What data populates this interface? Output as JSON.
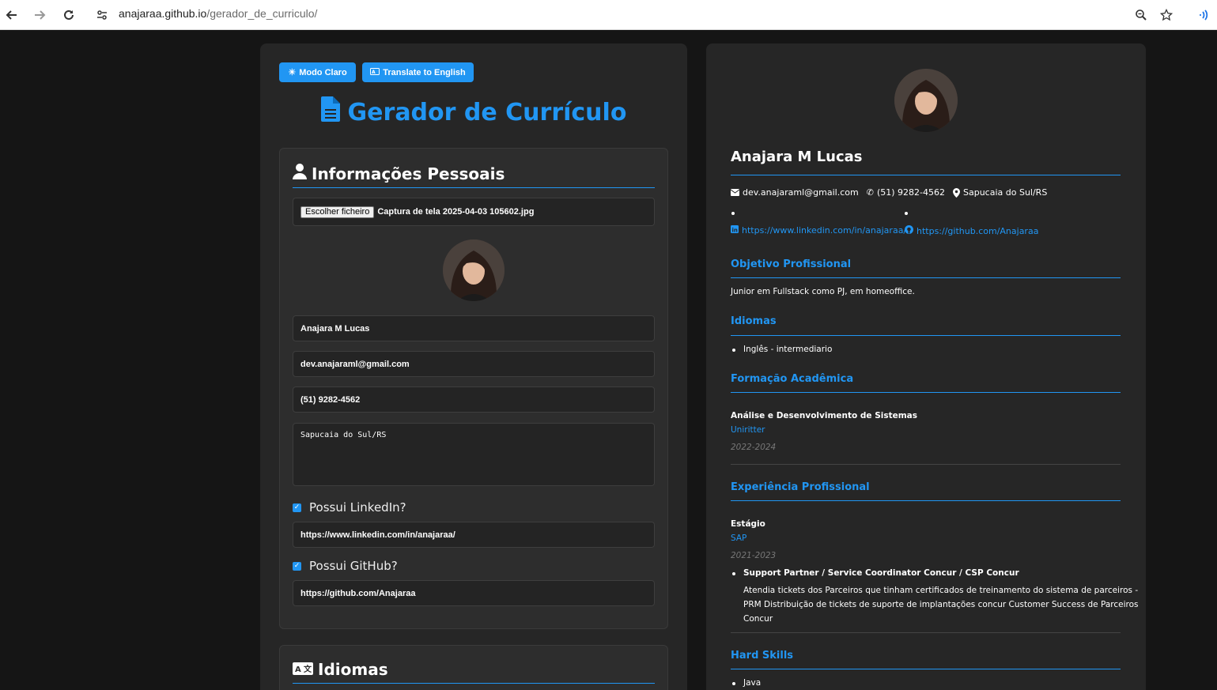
{
  "browser": {
    "url_host": "anajaraa.github.io",
    "url_path": "/gerador_de_curriculo/"
  },
  "toolbar": {
    "light_mode_label": "Modo Claro",
    "translate_label": "Translate to English"
  },
  "app": {
    "title": "Gerador de Currículo"
  },
  "personal": {
    "section_title": "Informações Pessoais",
    "file_button": "Escolher ficheiro",
    "file_name": "Captura de tela 2025-04-03 105602.jpg",
    "name": "Anajara M Lucas",
    "email": "dev.anajaraml@gmail.com",
    "phone": "(51) 9282-4562",
    "address": "Sapucaia do Sul/RS",
    "linkedin_label": "Possui LinkedIn?",
    "linkedin_url": "https://www.linkedin.com/in/anajaraa/",
    "github_label": "Possui GitHub?",
    "github_url": "https://github.com/Anajaraa"
  },
  "languages_card": {
    "section_title": "Idiomas"
  },
  "preview": {
    "name": "Anajara M Lucas",
    "email": "dev.anajaraml@gmail.com",
    "phone": "(51) 9282-4562",
    "location": "Sapucaia do Sul/RS",
    "linkedin": "https://www.linkedin.com/in/anajaraa/",
    "github": "https://github.com/Anajaraa",
    "objective_title": "Objetivo Profissional",
    "objective_text": "Junior em Fullstack como PJ, em homeoffice.",
    "languages_title": "Idiomas",
    "languages": [
      "Inglês - intermediario"
    ],
    "education_title": "Formação Acadêmica",
    "education": {
      "course": "Análise e Desenvolvimento de Sistemas",
      "institution": "Uniritter",
      "period": "2022-2024"
    },
    "experience_title": "Experiência Profissional",
    "experience": {
      "role": "Estágio",
      "company": "SAP",
      "period": "2021-2023",
      "item_title": "Support Partner / Service Coordinator Concur / CSP Concur",
      "item_desc_1": "Atendia tickets dos Parceiros que tinham certificados de treinamento do sistema de parceiros -",
      "item_desc_2": "PRM Distribuição de tickets de suporte de implantações concur Customer Success de Parceiros",
      "item_desc_3": "Concur"
    },
    "hard_skills_title": "Hard Skills",
    "hard_skills": [
      "Java"
    ]
  },
  "colors": {
    "accent": "#2196f3",
    "background": "#151515",
    "panel": "#262626"
  },
  "icons": {
    "back": "arrow-left-icon",
    "forward": "arrow-right-icon",
    "reload": "reload-icon",
    "site_settings": "site-settings-icon",
    "zoom": "zoom-icon",
    "bookmark": "star-icon",
    "cast": "cast-icon"
  }
}
